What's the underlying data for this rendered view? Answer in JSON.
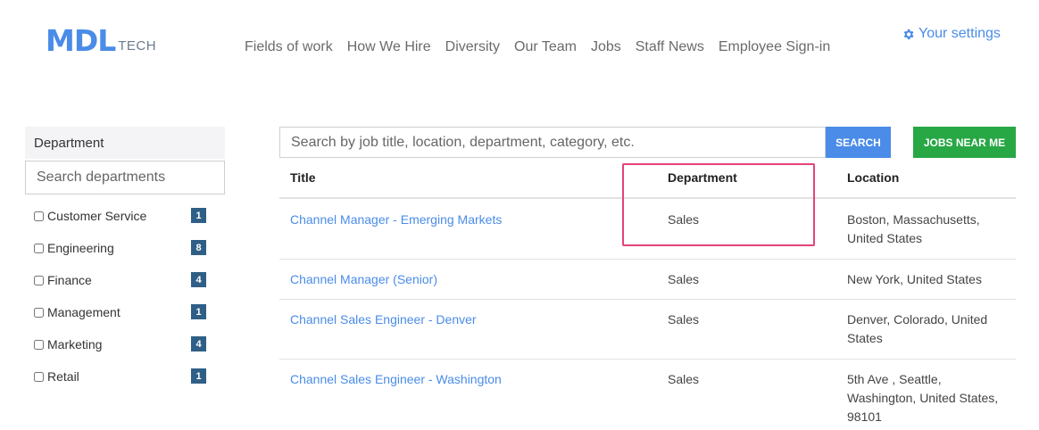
{
  "brand": {
    "main": "MDL",
    "sub": "TECH"
  },
  "nav": [
    "Fields of work",
    "How We Hire",
    "Diversity",
    "Our Team",
    "Jobs",
    "Staff News",
    "Employee Sign-in"
  ],
  "settings": {
    "label": "Your settings",
    "icon": "gear-icon"
  },
  "sidebar": {
    "title": "Department",
    "search_placeholder": "Search departments",
    "filters": [
      {
        "label": "Customer Service",
        "count": "1"
      },
      {
        "label": "Engineering",
        "count": "8"
      },
      {
        "label": "Finance",
        "count": "4"
      },
      {
        "label": "Management",
        "count": "1"
      },
      {
        "label": "Marketing",
        "count": "4"
      },
      {
        "label": "Retail",
        "count": "1"
      }
    ]
  },
  "search": {
    "placeholder": "Search by job title, location, department, category, etc.",
    "search_label": "SEARCH",
    "near_label": "JOBS NEAR ME"
  },
  "table": {
    "headers": {
      "title": "Title",
      "department": "Department",
      "location": "Location"
    },
    "rows": [
      {
        "title": "Channel Manager - Emerging Markets",
        "department": "Sales",
        "location": "Boston, Massachusetts, United States"
      },
      {
        "title": "Channel Manager (Senior)",
        "department": "Sales",
        "location": "New York, United States"
      },
      {
        "title": "Channel Sales Engineer - Denver",
        "department": "Sales",
        "location": "Denver, Colorado, United States"
      },
      {
        "title": "Channel Sales Engineer - Washington",
        "department": "Sales",
        "location": "5th Ave , Seattle, Washington, United States, 98101"
      }
    ]
  },
  "colors": {
    "accent": "#4a8ce8",
    "green": "#28a745",
    "badge": "#2f5f86",
    "highlight": "#e5437a"
  }
}
